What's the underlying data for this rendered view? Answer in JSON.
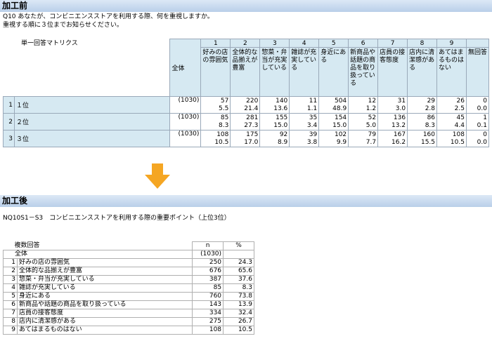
{
  "before": {
    "section_title": "加工前",
    "question_line1": "Q10 あなたが、コンビニエンスストアを利用する際、何を重視しますか。",
    "question_line2": "重視する順に３位までお知らせください。",
    "matrix_label": "単一回答マトリクス",
    "total_label": "全体",
    "columns": [
      {
        "num": "1",
        "label": "好みの店の雰囲気"
      },
      {
        "num": "2",
        "label": "全体的な品揃えが豊富"
      },
      {
        "num": "3",
        "label": "惣菜・弁当が充実している"
      },
      {
        "num": "4",
        "label": "雑誌が充実している"
      },
      {
        "num": "5",
        "label": "身近にある"
      },
      {
        "num": "6",
        "label": "新商品や話題の商品を取り扱っている"
      },
      {
        "num": "7",
        "label": "店員の接客態度"
      },
      {
        "num": "8",
        "label": "店内に清潔感がある"
      },
      {
        "num": "9",
        "label": "あてはまるものはない"
      },
      {
        "num": "",
        "label": "無回答"
      }
    ],
    "rows": [
      {
        "idx": "1",
        "label": "１位",
        "total": "(1030)",
        "n": [
          "57",
          "220",
          "140",
          "11",
          "504",
          "12",
          "31",
          "29",
          "26",
          "0"
        ],
        "pct": [
          "5.5",
          "21.4",
          "13.6",
          "1.1",
          "48.9",
          "1.2",
          "3.0",
          "2.8",
          "2.5",
          "0.0"
        ]
      },
      {
        "idx": "2",
        "label": "２位",
        "total": "(1030)",
        "n": [
          "85",
          "281",
          "155",
          "35",
          "154",
          "52",
          "136",
          "86",
          "45",
          "1"
        ],
        "pct": [
          "8.3",
          "27.3",
          "15.0",
          "3.4",
          "15.0",
          "5.0",
          "13.2",
          "8.3",
          "4.4",
          "0.1"
        ]
      },
      {
        "idx": "3",
        "label": "３位",
        "total": "(1030)",
        "n": [
          "108",
          "175",
          "92",
          "39",
          "102",
          "79",
          "167",
          "160",
          "108",
          "0"
        ],
        "pct": [
          "10.5",
          "17.0",
          "8.9",
          "3.8",
          "9.9",
          "7.7",
          "16.2",
          "15.5",
          "10.5",
          "0.0"
        ]
      }
    ]
  },
  "after": {
    "section_title": "加工後",
    "title": "NQ10S1－S3　コンビニエンスストアを利用する際の重要ポイント（上位3位）",
    "multi_label": "複数回答",
    "col_n": "n",
    "col_pct": "%",
    "total_label": "全体",
    "total_n": "(1030)",
    "rows": [
      {
        "idx": "1",
        "label": "好みの店の雰囲気",
        "n": "250",
        "pct": "24.3"
      },
      {
        "idx": "2",
        "label": "全体的な品揃えが豊富",
        "n": "676",
        "pct": "65.6"
      },
      {
        "idx": "3",
        "label": "惣菜・弁当が充実している",
        "n": "387",
        "pct": "37.6"
      },
      {
        "idx": "4",
        "label": "雑誌が充実している",
        "n": "85",
        "pct": "8.3"
      },
      {
        "idx": "5",
        "label": "身近にある",
        "n": "760",
        "pct": "73.8"
      },
      {
        "idx": "6",
        "label": "新商品や話題の商品を取り扱っている",
        "n": "143",
        "pct": "13.9"
      },
      {
        "idx": "7",
        "label": "店員の接客態度",
        "n": "334",
        "pct": "32.4"
      },
      {
        "idx": "8",
        "label": "店内に清潔感がある",
        "n": "275",
        "pct": "26.7"
      },
      {
        "idx": "9",
        "label": "あてはまるものはない",
        "n": "108",
        "pct": "10.5"
      }
    ]
  },
  "arrow_color": "#f5a623",
  "header_color": "#c5d8ee"
}
